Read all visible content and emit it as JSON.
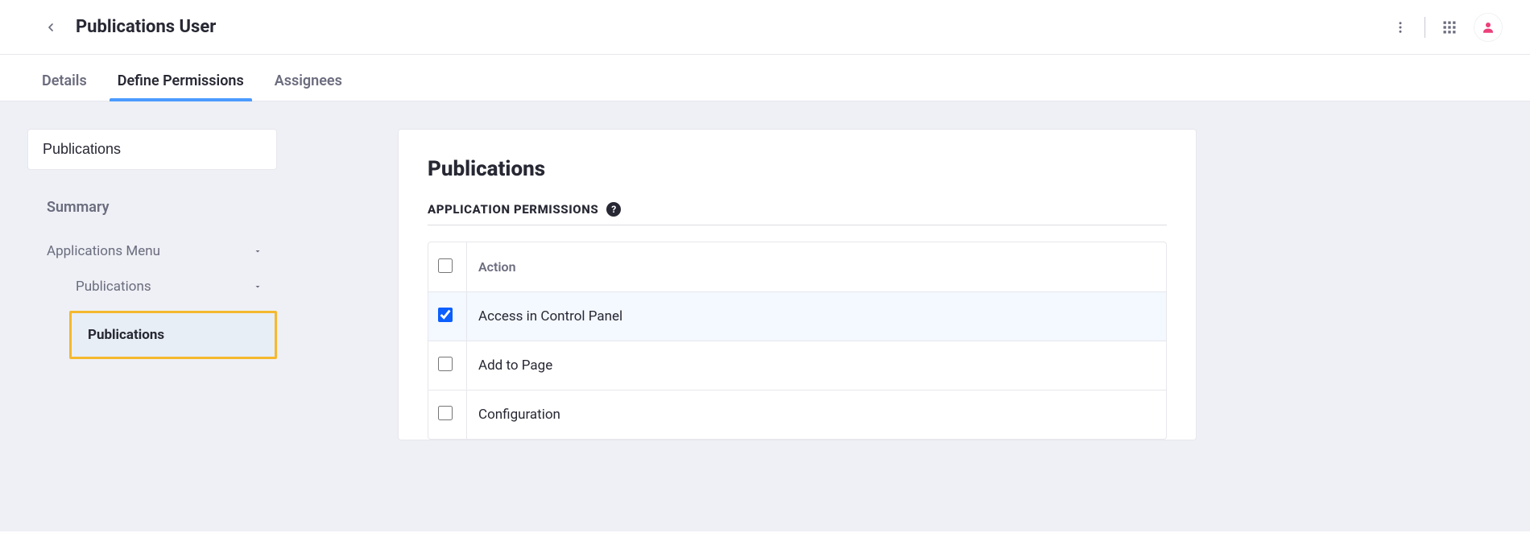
{
  "header": {
    "title": "Publications User"
  },
  "tabs": [
    {
      "id": "details",
      "label": "Details",
      "active": false
    },
    {
      "id": "define-permissions",
      "label": "Define Permissions",
      "active": true
    },
    {
      "id": "assignees",
      "label": "Assignees",
      "active": false
    }
  ],
  "sidebar": {
    "search_value": "Publications",
    "summary_label": "Summary",
    "tree": {
      "level0": {
        "label": "Applications Menu"
      },
      "level1": {
        "label": "Publications"
      },
      "leaf": {
        "label": "Publications",
        "highlighted": true
      }
    }
  },
  "main": {
    "title": "Publications",
    "section": "APPLICATION PERMISSIONS",
    "action_header": "Action",
    "permissions": [
      {
        "label": "Access in Control Panel",
        "checked": true
      },
      {
        "label": "Add to Page",
        "checked": false
      },
      {
        "label": "Configuration",
        "checked": false
      }
    ]
  },
  "icons": {
    "help": "?"
  }
}
